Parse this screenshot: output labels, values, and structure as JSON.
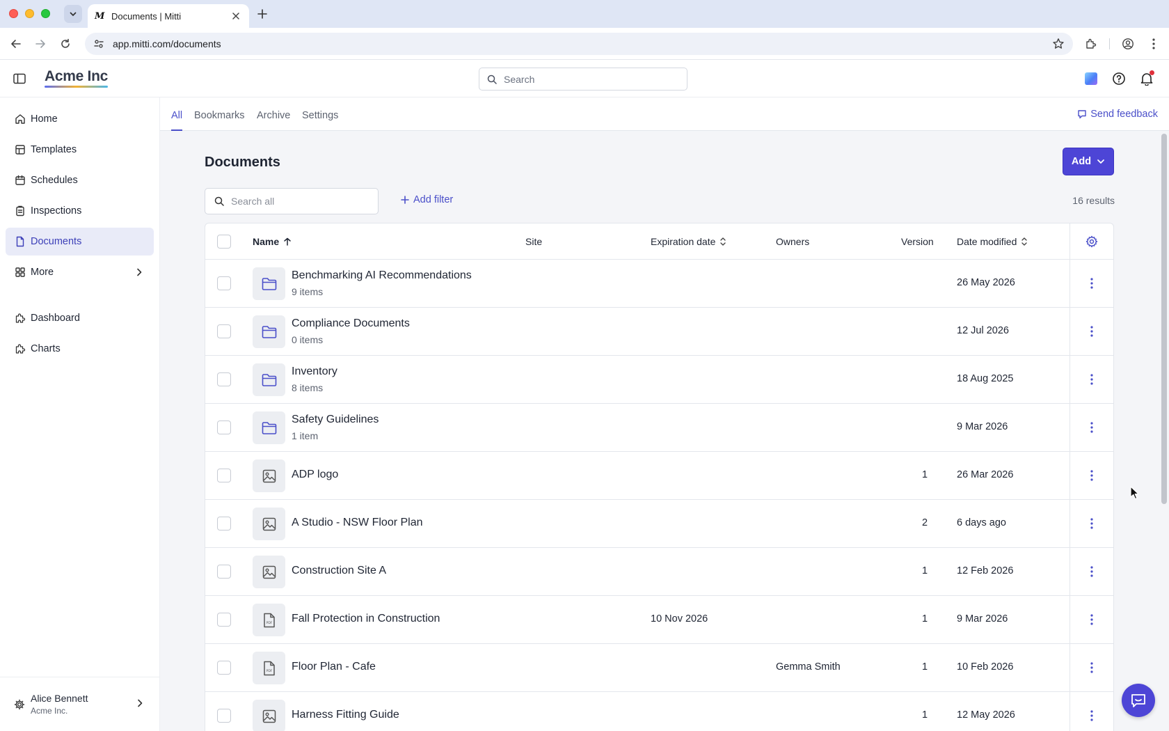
{
  "browser": {
    "tab_title": "Documents | Mitti",
    "favicon_letter": "M",
    "url": "app.mitti.com/documents"
  },
  "header": {
    "brand": "Acme Inc",
    "search_placeholder": "Search"
  },
  "sidebar": {
    "items": [
      {
        "label": "Home",
        "icon": "home-icon"
      },
      {
        "label": "Templates",
        "icon": "templates-icon"
      },
      {
        "label": "Schedules",
        "icon": "calendar-icon"
      },
      {
        "label": "Inspections",
        "icon": "clipboard-icon"
      },
      {
        "label": "Documents",
        "icon": "document-icon",
        "active": true
      },
      {
        "label": "More",
        "icon": "grid-icon"
      },
      {
        "label": "Dashboard",
        "icon": "puzzle-icon"
      },
      {
        "label": "Charts",
        "icon": "puzzle-icon"
      }
    ],
    "user": {
      "name": "Alice Bennett",
      "org": "Acme Inc."
    }
  },
  "subnav": {
    "tabs": [
      {
        "label": "All",
        "active": true
      },
      {
        "label": "Bookmarks"
      },
      {
        "label": "Archive"
      },
      {
        "label": "Settings"
      }
    ],
    "feedback_label": "Send feedback"
  },
  "main": {
    "title": "Documents",
    "add_label": "Add",
    "search_placeholder": "Search all",
    "add_filter_label": "Add filter",
    "results": "16 results"
  },
  "table": {
    "columns": {
      "name": "Name",
      "site": "Site",
      "expiration": "Expiration date",
      "owners": "Owners",
      "version": "Version",
      "modified": "Date modified"
    },
    "rows": [
      {
        "type": "folder",
        "name": "Benchmarking AI Recommendations",
        "sub": "9 items",
        "expiration": "",
        "owners": "",
        "version": "",
        "modified": "26 May 2026"
      },
      {
        "type": "folder",
        "name": "Compliance Documents",
        "sub": "0 items",
        "expiration": "",
        "owners": "",
        "version": "",
        "modified": "12 Jul 2026"
      },
      {
        "type": "folder",
        "name": "Inventory",
        "sub": "8 items",
        "expiration": "",
        "owners": "",
        "version": "",
        "modified": "18 Aug 2025"
      },
      {
        "type": "folder",
        "name": "Safety Guidelines",
        "sub": "1 item",
        "expiration": "",
        "owners": "",
        "version": "",
        "modified": "9 Mar 2026"
      },
      {
        "type": "image",
        "name": "ADP logo",
        "sub": "",
        "expiration": "",
        "owners": "",
        "version": "1",
        "modified": "26 Mar 2026"
      },
      {
        "type": "image",
        "name": "A Studio - NSW Floor Plan",
        "sub": "",
        "expiration": "",
        "owners": "",
        "version": "2",
        "modified": "6 days ago"
      },
      {
        "type": "image",
        "name": "Construction Site A",
        "sub": "",
        "expiration": "",
        "owners": "",
        "version": "1",
        "modified": "12 Feb 2026"
      },
      {
        "type": "pdf",
        "name": "Fall Protection in Construction",
        "sub": "",
        "expiration": "10 Nov 2026",
        "owners": "",
        "version": "1",
        "modified": "9 Mar 2026"
      },
      {
        "type": "pdf",
        "name": "Floor Plan - Cafe",
        "sub": "",
        "expiration": "",
        "owners": "Gemma Smith",
        "version": "1",
        "modified": "10 Feb 2026"
      },
      {
        "type": "image",
        "name": "Harness Fitting Guide",
        "sub": "",
        "expiration": "",
        "owners": "",
        "version": "1",
        "modified": "12 May 2026"
      }
    ]
  },
  "colors": {
    "accent": "#4d45d6",
    "active_nav_bg": "#e9ebf8",
    "page_bg": "#f4f5f8"
  }
}
